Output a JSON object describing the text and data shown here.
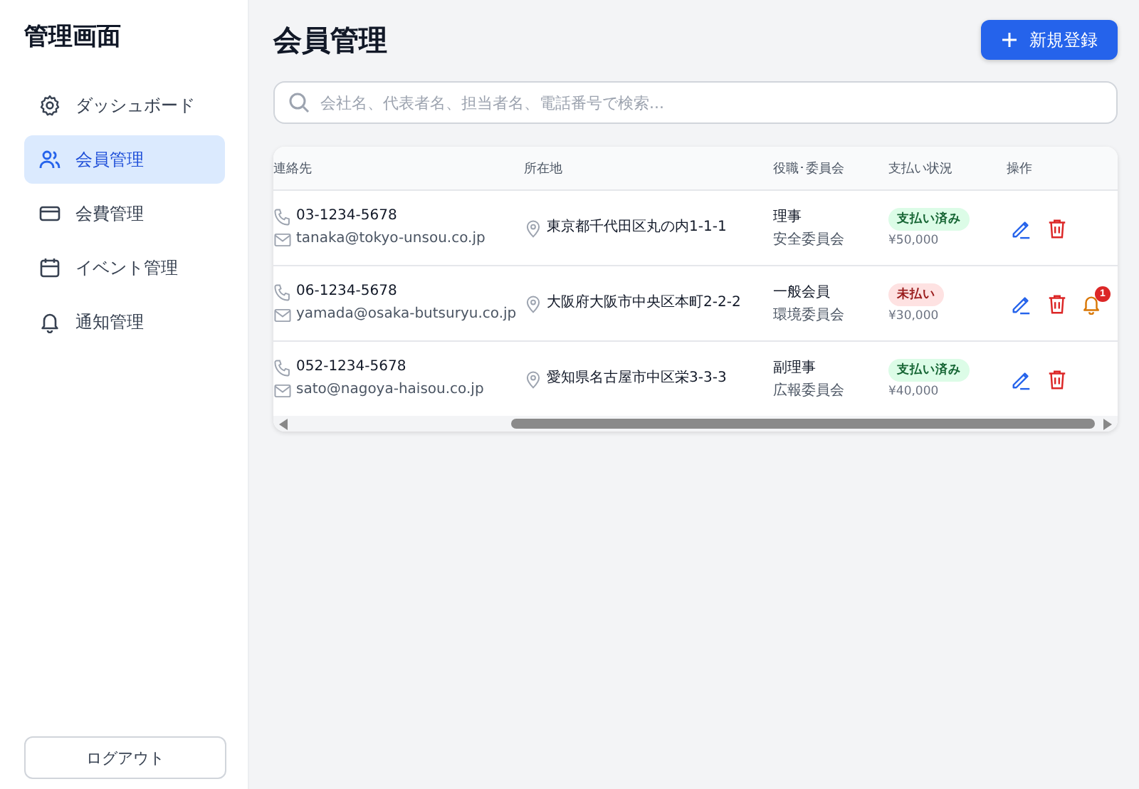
{
  "sidebar": {
    "title": "管理画面",
    "items": [
      {
        "label": "ダッシュボード",
        "selected": false
      },
      {
        "label": "会員管理",
        "selected": true
      },
      {
        "label": "会費管理",
        "selected": false
      },
      {
        "label": "イベント管理",
        "selected": false
      },
      {
        "label": "通知管理",
        "selected": false
      }
    ],
    "logout": "ログアウト"
  },
  "header": {
    "title": "会員管理",
    "new_button": "新規登録"
  },
  "search": {
    "placeholder": "会社名、代表者名、担当者名、電話番号で検索..."
  },
  "table": {
    "columns": [
      "連絡先",
      "所在地",
      "役職･委員会",
      "支払い状況",
      "操作"
    ],
    "rows": [
      {
        "phone": "03-1234-5678",
        "email": "tanaka@tokyo-unsou.co.jp",
        "address": "東京都千代田区丸の内1-1-1",
        "position": "理事",
        "committee": "安全委員会",
        "payment": {
          "kind": "paid",
          "label": "支払い済み",
          "amount": "¥50,000"
        }
      },
      {
        "phone": "06-1234-5678",
        "email": "yamada@osaka-butsuryu.co.jp",
        "address": "大阪府大阪市中央区本町2-2-2",
        "position": "一般会員",
        "committee": "環境委員会",
        "payment": {
          "kind": "unpaid",
          "label": "未払い",
          "amount": "¥30,000"
        },
        "reminder": {
          "count": "1"
        }
      },
      {
        "phone": "052-1234-5678",
        "email": "sato@nagoya-haisou.co.jp",
        "address": "愛知県名古屋市中区栄3-3-3",
        "position": "副理事",
        "committee": "広報委員会",
        "payment": {
          "kind": "paid",
          "label": "支払い済み",
          "amount": "¥40,000"
        }
      }
    ]
  }
}
